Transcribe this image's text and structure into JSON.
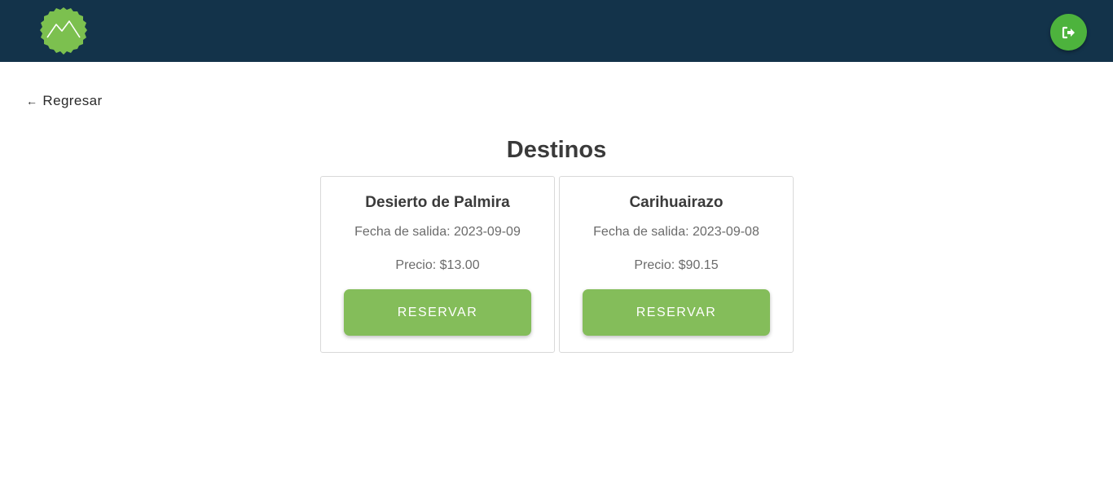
{
  "header": {
    "background_color": "#13334a",
    "logo_icon": "mountain-badge-icon",
    "logout_icon": "sign-out-icon",
    "accent_color": "#4db33d"
  },
  "nav": {
    "back_label": "Regresar"
  },
  "main": {
    "title": "Destinos",
    "destinations": [
      {
        "name": "Desierto de Palmira",
        "departure": "Fecha de salida: 2023-09-09",
        "price": "Precio: $13.00",
        "button_label": "RESERVAR"
      },
      {
        "name": "Carihuairazo",
        "departure": "Fecha de salida: 2023-09-08",
        "price": "Precio: $90.15",
        "button_label": "RESERVAR"
      }
    ],
    "button_color": "#84bd5a"
  }
}
